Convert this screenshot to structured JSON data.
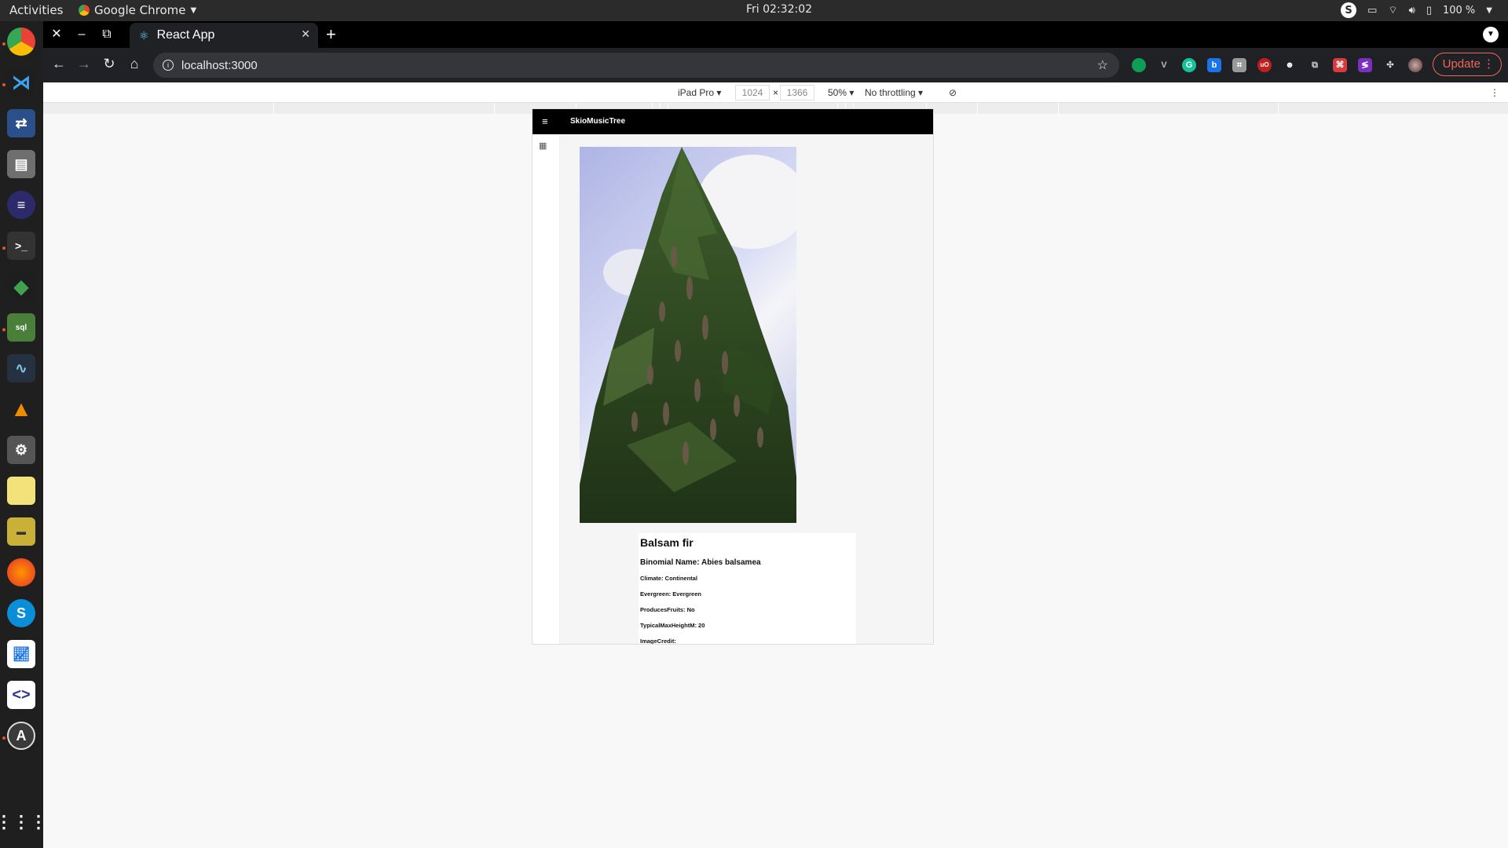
{
  "system": {
    "activities": "Activities",
    "app_menu": "Google Chrome",
    "clock": "Fri 02:32:02",
    "battery": "100 %"
  },
  "browser": {
    "tab_title": "React App",
    "url": "localhost:3000",
    "update_label": "Update"
  },
  "devtools": {
    "device": "iPad Pro",
    "width": "1024",
    "height": "1366",
    "zoom": "50%",
    "throttling": "No throttling"
  },
  "app": {
    "title": "SkioMusicTree",
    "tree": {
      "common_name": "Balsam fir",
      "binomial": "Binomial Name: Abies balsamea",
      "climate": "Climate: Continental",
      "evergreen": "Evergreen: Evergreen",
      "produces_fruits": "ProducesFruits: No",
      "max_height": "TypicalMaxHeightM: 20",
      "image_credit": "ImageCredit:"
    }
  },
  "colors": {
    "accent_update": "#ee675c",
    "ubuntu_orange": "#e95420",
    "appbar": "#000000"
  }
}
